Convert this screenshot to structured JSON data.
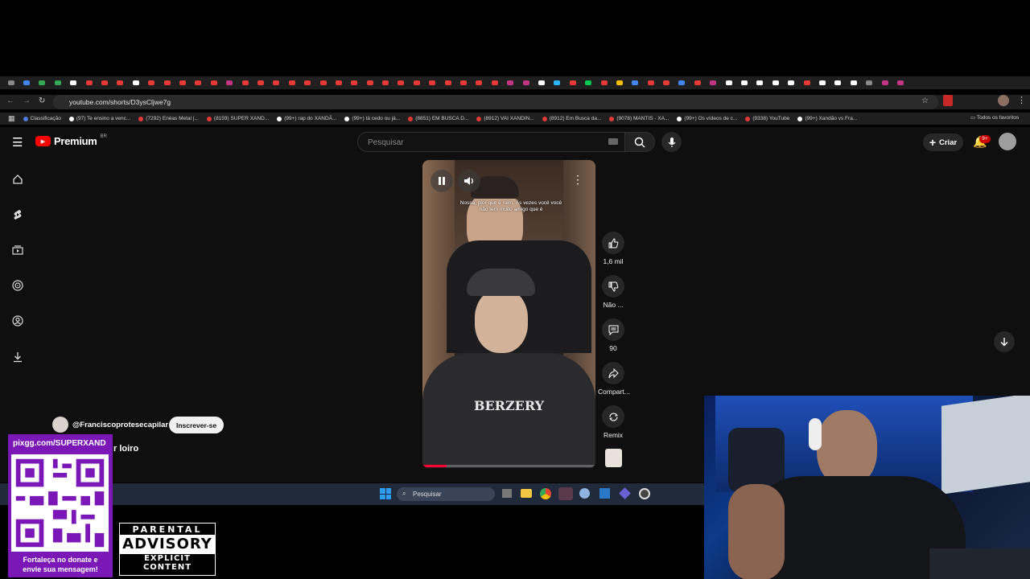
{
  "browser": {
    "url": "youtube.com/shorts/D3ysCljwe7g",
    "bookmarks": [
      {
        "label": "Classificação",
        "color": "#4e7bdc"
      },
      {
        "label": "(97) Te ensino a venc...",
        "color": "#ffffff"
      },
      {
        "label": "(7292) Enéas Metal |...",
        "color": "#e53935"
      },
      {
        "label": "(8159) SUPER XAND...",
        "color": "#e53935"
      },
      {
        "label": "(99+) rap do XANDÃ...",
        "color": "#ffffff"
      },
      {
        "label": "(99+) tá cedo ou já...",
        "color": "#ffffff"
      },
      {
        "label": "(8851) EM BUSCA D...",
        "color": "#e53935"
      },
      {
        "label": "(8912) VAI XANDIN...",
        "color": "#e53935"
      },
      {
        "label": "(8912) Em Busca da...",
        "color": "#e53935"
      },
      {
        "label": "(9078) MANTIS - XA...",
        "color": "#e53935"
      },
      {
        "label": "(99+) Os vídeos de c...",
        "color": "#ffffff"
      },
      {
        "label": "(9338) YouTube",
        "color": "#e53935"
      },
      {
        "label": "(99+) Xandão vs Fra...",
        "color": "#ffffff"
      }
    ],
    "all_favorites": "Todos os favoritos"
  },
  "youtube": {
    "logo_text": "Premium",
    "region": "BR",
    "search_placeholder": "Pesquisar",
    "create_label": "Criar",
    "notif_badge": "9+",
    "short": {
      "caption": "Nossa, pior que é ruim. Às vezes você você não tem muito amigo que é",
      "shirt_text": "BERZERY",
      "channel": "@Franciscoprotesecapilar",
      "subscribe": "Inscrever-se",
      "title_partial": "r loiro",
      "likes": "1,6 mil",
      "dislike": "Não ...",
      "comments": "90",
      "share": "Compart...",
      "remix": "Remix"
    }
  },
  "taskbar": {
    "search": "Pesquisar"
  },
  "overlay": {
    "donate_url": "pixgg.com/SUPERXAND",
    "donate_text_1": "Fortaleça no donate e",
    "donate_text_2": "envie sua mensagem!",
    "advisory_top": "PARENTAL",
    "advisory_mid": "ADVISORY",
    "advisory_bottom": "EXPLICIT CONTENT"
  }
}
